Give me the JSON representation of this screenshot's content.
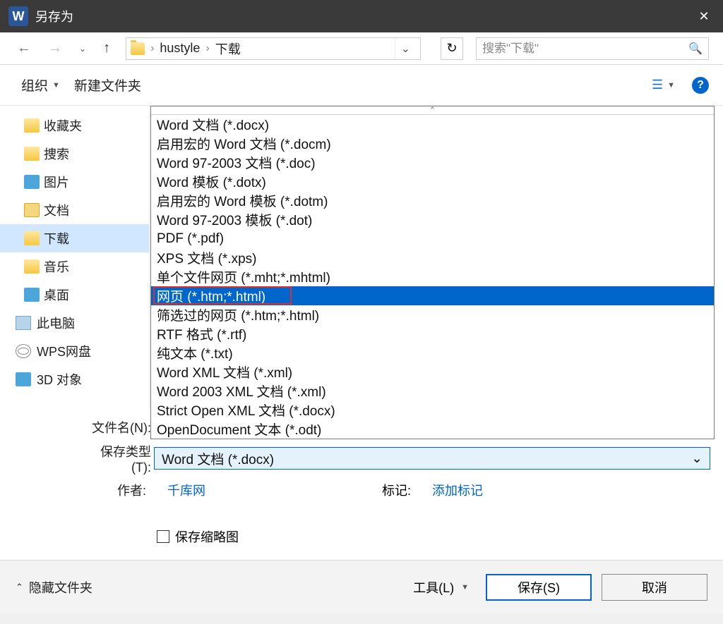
{
  "window": {
    "title": "另存为"
  },
  "path": {
    "segments": [
      "hustyle",
      "下载"
    ]
  },
  "search": {
    "placeholder": "搜索\"下载\""
  },
  "toolbar": {
    "organize": "组织",
    "newfolder": "新建文件夹"
  },
  "sidebar": {
    "items": [
      {
        "label": "收藏夹",
        "icon": "star"
      },
      {
        "label": "捜索",
        "icon": "search"
      },
      {
        "label": "图片",
        "icon": "pic"
      },
      {
        "label": "文档",
        "icon": "doc"
      },
      {
        "label": "下载",
        "icon": "dl",
        "selected": true
      },
      {
        "label": "音乐",
        "icon": "music"
      },
      {
        "label": "桌面",
        "icon": "desktop"
      },
      {
        "label": "此电脑",
        "icon": "pc",
        "level": 2
      },
      {
        "label": "WPS网盘",
        "icon": "cloud",
        "level": 2
      },
      {
        "label": "3D 对象",
        "icon": "3d",
        "level": 2
      }
    ]
  },
  "filetype_dropdown": {
    "selected": "Word 文档 (*.docx)",
    "highlighted_index": 9,
    "options": [
      "Word 文档 (*.docx)",
      "启用宏的 Word 文档 (*.docm)",
      "Word 97-2003 文档 (*.doc)",
      "Word 模板 (*.dotx)",
      "启用宏的 Word 模板 (*.dotm)",
      "Word 97-2003 模板 (*.dot)",
      "PDF (*.pdf)",
      "XPS 文档 (*.xps)",
      "单个文件网页 (*.mht;*.mhtml)",
      "网页 (*.htm;*.html)",
      "筛选过的网页 (*.htm;*.html)",
      "RTF 格式 (*.rtf)",
      "纯文本 (*.txt)",
      "Word XML 文档 (*.xml)",
      "Word 2003 XML 文档 (*.xml)",
      "Strict Open XML 文档 (*.docx)",
      "OpenDocument 文本 (*.odt)"
    ]
  },
  "fields": {
    "filename_label": "文件名(N):",
    "savetype_label": "保存类型(T):",
    "author_label": "作者:",
    "author_value": "千库网",
    "tag_label": "标记:",
    "tag_placeholder": "添加标记",
    "thumbnail_label": "保存缩略图"
  },
  "footer": {
    "hidefolders": "隐藏文件夹",
    "tools": "工具(L)",
    "save": "保存(S)",
    "cancel": "取消"
  }
}
